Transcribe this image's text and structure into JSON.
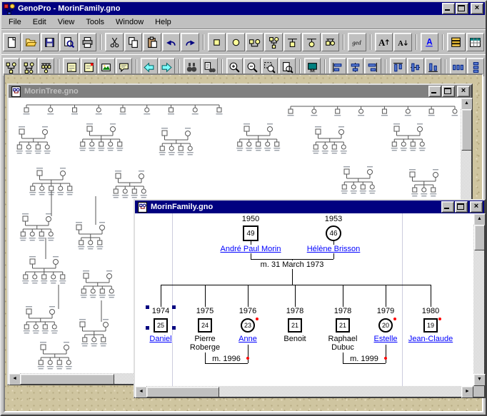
{
  "app": {
    "title": "GenoPro - MorinFamily.gno"
  },
  "window_controls": [
    {
      "name": "minimize"
    },
    {
      "name": "maximize"
    },
    {
      "name": "close"
    }
  ],
  "menu_bar": {
    "items": [
      "File",
      "Edit",
      "View",
      "Tools",
      "Window",
      "Help"
    ]
  },
  "toolbar_row1": [
    {
      "name": "new-document"
    },
    {
      "name": "open-file"
    },
    {
      "name": "save-file"
    },
    {
      "name": "print-preview"
    },
    {
      "name": "print"
    },
    {
      "sep": true
    },
    {
      "name": "cut"
    },
    {
      "name": "copy"
    },
    {
      "name": "paste"
    },
    {
      "name": "undo"
    },
    {
      "name": "redo"
    },
    {
      "sep": true
    },
    {
      "name": "new-male"
    },
    {
      "name": "new-female"
    },
    {
      "name": "new-family"
    },
    {
      "name": "add-parents"
    },
    {
      "name": "add-son"
    },
    {
      "name": "add-daughter"
    },
    {
      "name": "add-sibling"
    },
    {
      "sep": true
    },
    {
      "name": "gedcom",
      "label": "ged"
    },
    {
      "sep": true
    },
    {
      "name": "font-larger"
    },
    {
      "name": "font-smaller"
    },
    {
      "sep": true
    },
    {
      "name": "hyperlink-style"
    },
    {
      "sep": true
    },
    {
      "name": "report-book"
    },
    {
      "name": "table-view"
    }
  ],
  "toolbar_row2": [
    {
      "name": "tree-layout-1"
    },
    {
      "name": "tree-layout-2"
    },
    {
      "name": "tree-layout-3"
    },
    {
      "sep": true
    },
    {
      "name": "show-labels"
    },
    {
      "name": "show-dates"
    },
    {
      "name": "show-pictures"
    },
    {
      "name": "show-comments"
    },
    {
      "sep": true
    },
    {
      "name": "nav-back"
    },
    {
      "name": "nav-forward"
    },
    {
      "sep": true
    },
    {
      "name": "find"
    },
    {
      "name": "find-next"
    },
    {
      "sep": true
    },
    {
      "name": "zoom-in"
    },
    {
      "name": "zoom-out"
    },
    {
      "name": "zoom-selection"
    },
    {
      "name": "zoom-page"
    },
    {
      "sep": true
    },
    {
      "name": "display-options"
    },
    {
      "sep": true
    },
    {
      "name": "align-left"
    },
    {
      "name": "align-center-h"
    },
    {
      "name": "align-right"
    },
    {
      "sep": true
    },
    {
      "name": "align-top"
    },
    {
      "name": "align-middle"
    },
    {
      "name": "align-bottom"
    },
    {
      "sep": true
    },
    {
      "name": "distribute-h"
    },
    {
      "name": "distribute-v"
    }
  ],
  "tree_window": {
    "title": "MorinTree.gno"
  },
  "family_window": {
    "title": "MorinFamily.gno",
    "parents": [
      {
        "year": "1950",
        "age": "49",
        "gender": "male",
        "name": "André Paul Morin",
        "hyperlink": true
      },
      {
        "year": "1953",
        "age": "46",
        "gender": "female",
        "name": "Hélène Brisson",
        "hyperlink": true
      }
    ],
    "parents_marriage_label": "m. 31 March 1973",
    "children": [
      {
        "year": "1974",
        "age": "25",
        "gender": "male",
        "name": "Daniel",
        "hyperlink": true,
        "selected": true
      },
      {
        "year": "1975",
        "age": "24",
        "gender": "male",
        "name": "Pierre",
        "name2": "Roberge",
        "hyperlink": false
      },
      {
        "year": "1976",
        "age": "23",
        "gender": "female",
        "name": "Anne",
        "hyperlink": true,
        "flagged": true
      },
      {
        "year": "1978",
        "age": "21",
        "gender": "male",
        "name": "Benoit",
        "hyperlink": false
      },
      {
        "year": "1978",
        "age": "21",
        "gender": "male",
        "name": "Raphael",
        "name2": "Dubuc",
        "hyperlink": false
      },
      {
        "year": "1979",
        "age": "20",
        "gender": "female",
        "name": "Estelle",
        "hyperlink": true,
        "flagged": true
      },
      {
        "year": "1980",
        "age": "19",
        "gender": "male",
        "name": "Jean-Claude",
        "hyperlink": true,
        "flagged": true
      }
    ],
    "marriages": [
      {
        "label": "m. 1996",
        "between": [
          "Pierre",
          "Anne"
        ],
        "flagged": true
      },
      {
        "label": "m. 1999",
        "between": [
          "Raphael",
          "Estelle"
        ],
        "flagged": true
      }
    ]
  },
  "colors": {
    "titlebar_active": "#000080",
    "titlebar_inactive": "#808080",
    "hyperlink": "#0000ff",
    "flag_dot": "#ff0000",
    "selection_handle": "#000080"
  }
}
